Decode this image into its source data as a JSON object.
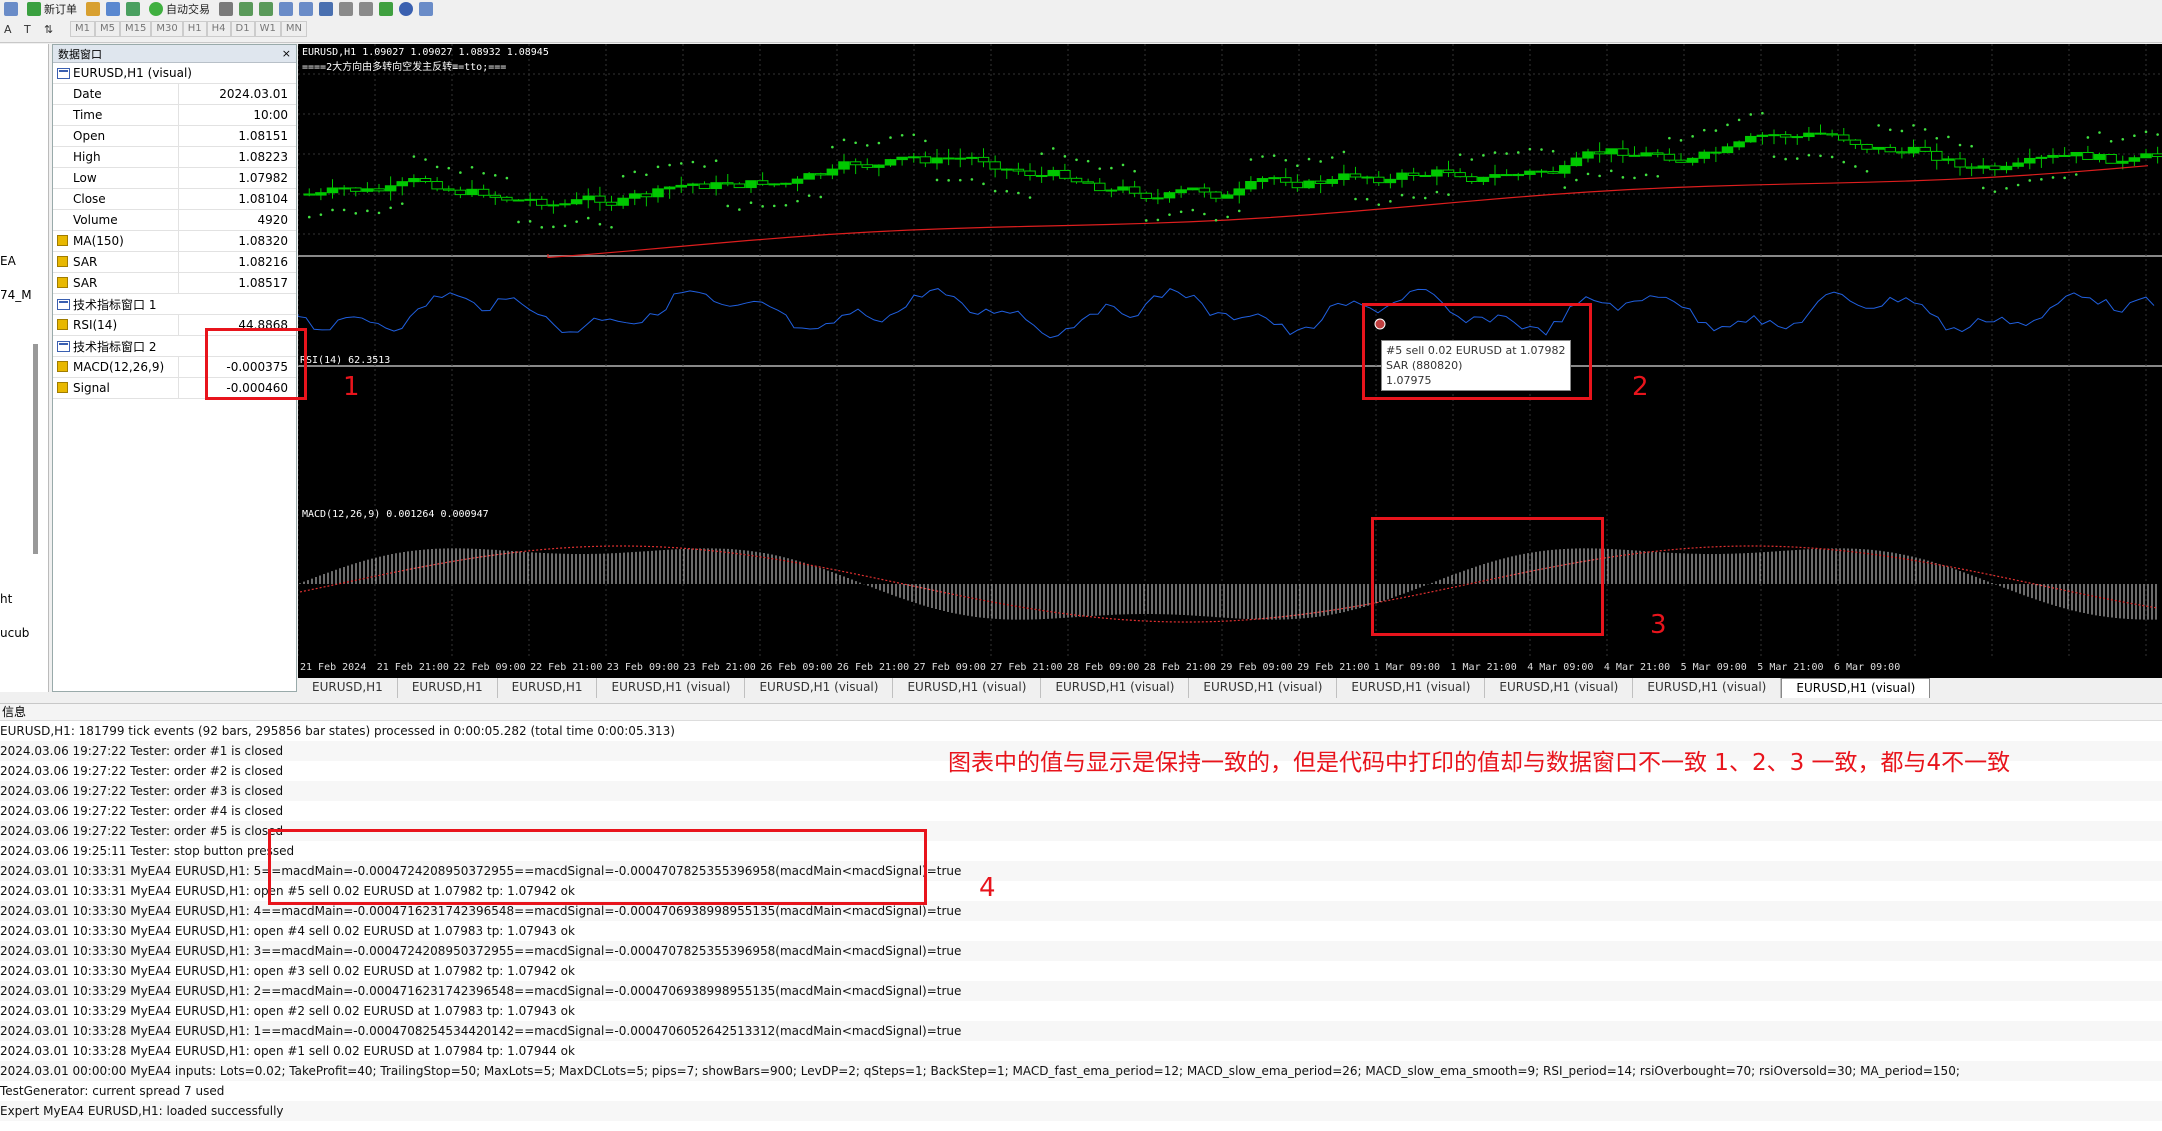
{
  "toolbar": {
    "new_order": "新订单",
    "auto_trade": "自动交易",
    "timeframes": [
      "M1",
      "M5",
      "M15",
      "M30",
      "H1",
      "H4",
      "D1",
      "W1",
      "MN"
    ]
  },
  "navigator": {
    "fragments": [
      "EA",
      "74_M",
      "ht",
      "ucub"
    ]
  },
  "data_window": {
    "title": "数据窗口",
    "close": "×",
    "symbol": "EURUSD,H1 (visual)",
    "rows": [
      {
        "label": "Date",
        "value": "2024.03.01"
      },
      {
        "label": "Time",
        "value": "10:00"
      },
      {
        "label": "Open",
        "value": "1.08151"
      },
      {
        "label": "High",
        "value": "1.08223"
      },
      {
        "label": "Low",
        "value": "1.07982"
      },
      {
        "label": "Close",
        "value": "1.08104"
      },
      {
        "label": "Volume",
        "value": "4920"
      }
    ],
    "indicators_main": [
      {
        "label": "MA(150)",
        "value": "1.08320"
      },
      {
        "label": "SAR",
        "value": "1.08216"
      },
      {
        "label": "SAR",
        "value": "1.08517"
      }
    ],
    "window1_title": "技术指标窗口 1",
    "window1": [
      {
        "label": "RSI(14)",
        "value": "44.8868"
      }
    ],
    "window2_title": "技术指标窗口 2",
    "window2": [
      {
        "label": "MACD(12,26,9)",
        "value": "-0.000375"
      },
      {
        "label": "Signal",
        "value": "-0.000460"
      }
    ]
  },
  "chart": {
    "header": "EURUSD,H1  1.09027 1.09027 1.08932 1.08945",
    "comment": "====2大方向由多转向空发主反转≡=tto;===",
    "rsi_label": "RSI(14) 62.3513",
    "macd_label": "MACD(12,26,9) 0.001264 0.000947",
    "tooltip": [
      "#5 sell 0.02 EURUSD at 1.07982",
      "SAR (880820)",
      "1.07975"
    ],
    "time_axis": [
      "21 Feb 2024",
      "21 Feb 21:00",
      "22 Feb 09:00",
      "22 Feb 21:00",
      "23 Feb 09:00",
      "23 Feb 21:00",
      "26 Feb 09:00",
      "26 Feb 21:00",
      "27 Feb 09:00",
      "27 Feb 21:00",
      "28 Feb 09:00",
      "28 Feb 21:00",
      "29 Feb 09:00",
      "29 Feb 21:00",
      "1 Mar 09:00",
      "1 Mar 21:00",
      "4 Mar 09:00",
      "4 Mar 21:00",
      "5 Mar 09:00",
      "5 Mar 21:00",
      "6 Mar 09:00"
    ],
    "colors": {
      "bull": "#00c800",
      "bear": "#00c800",
      "ma": "#dc1e1e",
      "sar": "#40e040",
      "rsi": "#2060e0",
      "macd": "#d8d8d8",
      "signal": "#e03030"
    }
  },
  "tabs": [
    "EURUSD,H1",
    "EURUSD,H1",
    "EURUSD,H1",
    "EURUSD,H1 (visual)",
    "EURUSD,H1 (visual)",
    "EURUSD,H1 (visual)",
    "EURUSD,H1 (visual)",
    "EURUSD,H1 (visual)",
    "EURUSD,H1 (visual)",
    "EURUSD,H1 (visual)",
    "EURUSD,H1 (visual)",
    "EURUSD,H1 (visual)"
  ],
  "journal": {
    "header": "信息",
    "lines": [
      "EURUSD,H1: 181799 tick events (92 bars, 295856 bar states) processed in 0:00:05.282 (total time 0:00:05.313)",
      "2024.03.06 19:27:22  Tester: order #1 is closed",
      "2024.03.06 19:27:22  Tester: order #2 is closed",
      "2024.03.06 19:27:22  Tester: order #3 is closed",
      "2024.03.06 19:27:22  Tester: order #4 is closed",
      "2024.03.06 19:27:22  Tester: order #5 is closed",
      "2024.03.06 19:25:11  Tester: stop button pressed",
      "2024.03.01 10:33:31  MyEA4 EURUSD,H1: 5==macdMain=-0.0004724208950372955==macdSignal=-0.0004707825355396958(macdMain<macdSignal)=true",
      "2024.03.01 10:33:31  MyEA4 EURUSD,H1: open #5 sell 0.02 EURUSD at 1.07982 tp: 1.07942 ok",
      "2024.03.01 10:33:30  MyEA4 EURUSD,H1: 4==macdMain=-0.0004716231742396548==macdSignal=-0.0004706938998955135(macdMain<macdSignal)=true",
      "2024.03.01 10:33:30  MyEA4 EURUSD,H1: open #4 sell 0.02 EURUSD at 1.07983 tp: 1.07943 ok",
      "2024.03.01 10:33:30  MyEA4 EURUSD,H1: 3==macdMain=-0.0004724208950372955==macdSignal=-0.0004707825355396958(macdMain<macdSignal)=true",
      "2024.03.01 10:33:30  MyEA4 EURUSD,H1: open #3 sell 0.02 EURUSD at 1.07982 tp: 1.07942 ok",
      "2024.03.01 10:33:29  MyEA4 EURUSD,H1: 2==macdMain=-0.0004716231742396548==macdSignal=-0.0004706938998955135(macdMain<macdSignal)=true",
      "2024.03.01 10:33:29  MyEA4 EURUSD,H1: open #2 sell 0.02 EURUSD at 1.07983 tp: 1.07943 ok",
      "2024.03.01 10:33:28  MyEA4 EURUSD,H1: 1==macdMain=-0.0004708254534420142==macdSignal=-0.0004706052642513312(macdMain<macdSignal)=true",
      "2024.03.01 10:33:28  MyEA4 EURUSD,H1: open #1 sell 0.02 EURUSD at 1.07984 tp: 1.07944 ok",
      "2024.03.01 00:00:00  MyEA4 inputs: Lots=0.02; TakeProfit=40; TrailingStop=50; MaxLots=5; MaxDCLots=5; pips=7; showBars=900; LevDP=2; qSteps=1; BackStep=1; MACD_fast_ema_period=12; MACD_slow_ema_period=26; MACD_slow_ema_smooth=9; RSI_period=14; rsiOverbought=70; rsiOversold=30; MA_period=150;",
      "TestGenerator: current spread 7 used",
      "Expert MyEA4 EURUSD,H1: loaded successfully"
    ]
  },
  "annotations": {
    "note": "图表中的值与显示是保持一致的，但是代码中打印的值却与数据窗口不一致 1、2、3 一致，都与4不一致",
    "n1": "1",
    "n2": "2",
    "n3": "3",
    "n4": "4"
  }
}
